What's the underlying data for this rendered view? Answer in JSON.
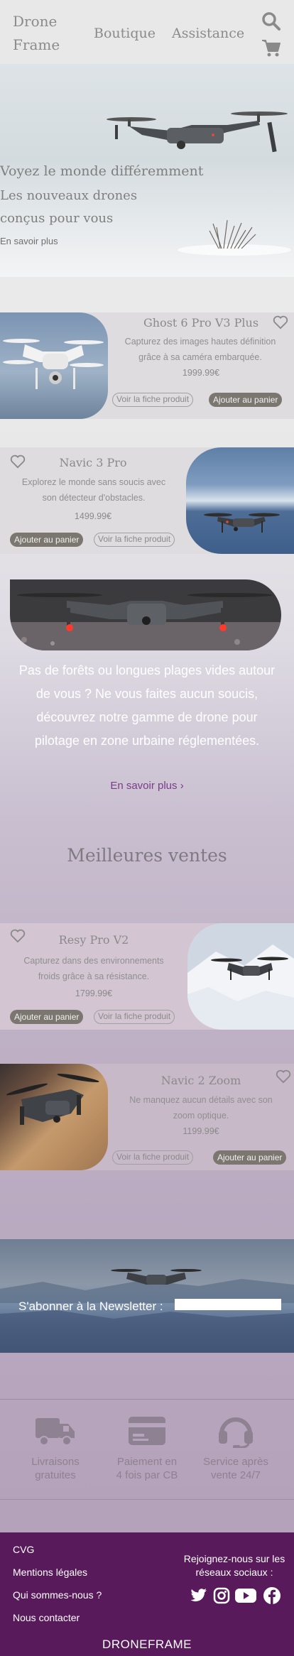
{
  "header": {
    "logo": "Drone Frame",
    "nav": [
      "Boutique",
      "Assistance"
    ],
    "icons": [
      "search-icon",
      "cart-icon"
    ]
  },
  "hero": {
    "title": "Voyez le monde différemment",
    "subtitle_line1": "Les nouveaux drones",
    "subtitle_line2": "conçus pour vous",
    "link": "En savoir plus"
  },
  "products": [
    {
      "name": "Ghost 6 Pro V3 Plus",
      "description": "Capturez des images hautes définition grâce à sa caméra embarquée.",
      "price": "1999.99€",
      "details_label": "Voir la fiche produit",
      "cart_label": "Ajouter au panier"
    },
    {
      "name": "Navic 3 Pro",
      "description": "Explorez le monde sans soucis avec son détecteur d'obstacles.",
      "price": "1499.99€",
      "details_label": "Voir la fiche produit",
      "cart_label": "Ajouter au panier"
    }
  ],
  "promo": {
    "text": "Pas de forêts ou longues plages vides autour de vous ? Ne vous faites aucun soucis, découvrez notre gamme de drone pour pilotage en zone urbaine réglementées.",
    "link": "En savoir plus ›"
  },
  "best_sellers": {
    "title": "Meilleures ventes",
    "items": [
      {
        "name": "Resy Pro V2",
        "description": "Capturez dans des environnements froids grâce à sa résistance.",
        "price": "1799.99€",
        "details_label": "Voir la fiche produit",
        "cart_label": "Ajouter au panier"
      },
      {
        "name": "Navic 2 Zoom",
        "description": "Ne manquez aucun détails avec son zoom optique.",
        "price": "1199.99€",
        "details_label": "Voir la fiche produit",
        "cart_label": "Ajouter au panier"
      }
    ]
  },
  "newsletter": {
    "label": "S'abonner à la Newsletter :",
    "input_value": ""
  },
  "features": [
    {
      "icon": "truck-icon",
      "label_line1": "Livraisons",
      "label_line2": "gratuites"
    },
    {
      "icon": "credit-card-icon",
      "label_line1": "Paiement en",
      "label_line2": "4 fois par CB"
    },
    {
      "icon": "headset-icon",
      "label_line1": "Service après",
      "label_line2": "vente 24/7"
    }
  ],
  "footer": {
    "links": [
      "CVG",
      "Mentions légales",
      "Qui sommes-nous ?",
      "Nous contacter"
    ],
    "social_label": "Rejoignez-nous sur les réseaux sociaux :",
    "social_icons": [
      "twitter-icon",
      "instagram-icon",
      "youtube-icon",
      "facebook-icon"
    ],
    "brand": "DRONEFRAME"
  },
  "colors": {
    "footer_bg": "#581a5a",
    "promo_link": "#7c3a8a",
    "button_fill": "#7b7770"
  }
}
